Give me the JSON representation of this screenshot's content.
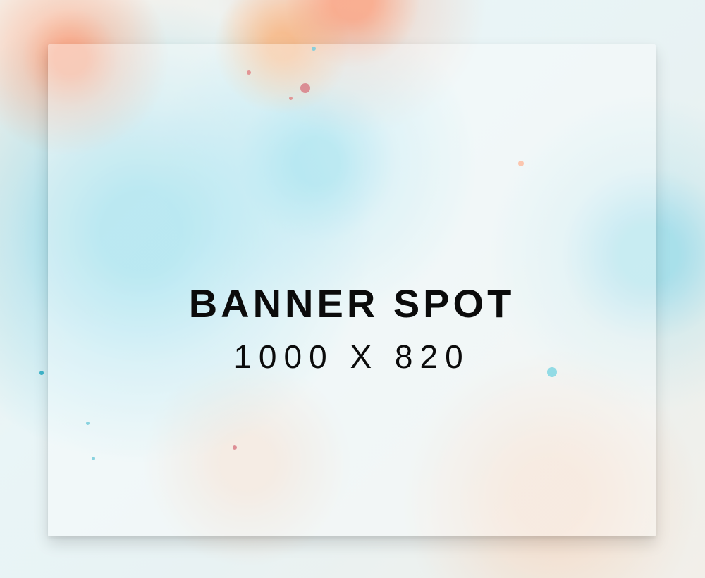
{
  "banner": {
    "headline": "BANNER SPOT",
    "size_text": "1000 X 820"
  },
  "colors": {
    "accent_teal": "#5cc7dc",
    "accent_orange": "#ff7b4a",
    "panel_white": "#ffffff",
    "text": "#0b0b0b"
  },
  "icons": {
    "background": "marbled-watercolor-background-icon"
  }
}
